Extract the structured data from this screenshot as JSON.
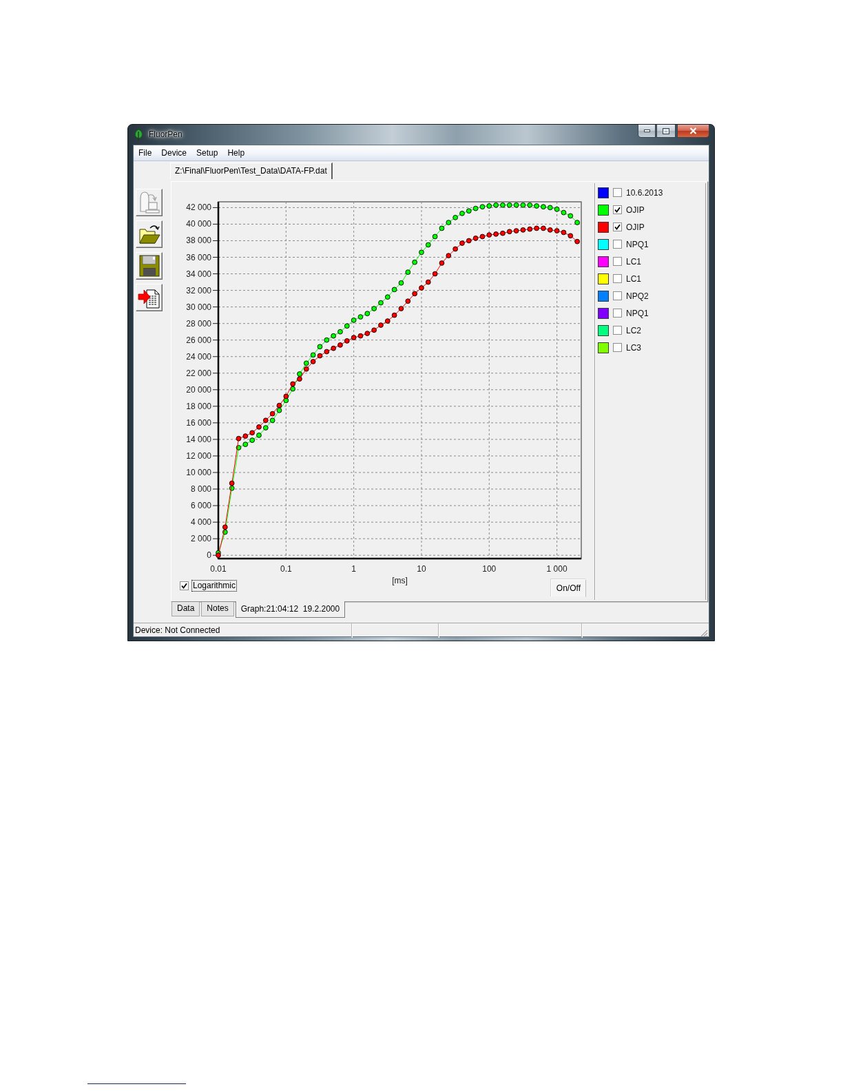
{
  "window": {
    "title": "FluorPen"
  },
  "menu": [
    "File",
    "Device",
    "Setup",
    "Help"
  ],
  "file_tabs": [
    {
      "label": "Z:\\Final\\FluorPen\\Test_Data\\DATA-FP.dat",
      "selected": true
    }
  ],
  "toolbar": [
    {
      "disabled": true
    },
    {
      "disabled": false
    },
    {
      "disabled": false
    },
    {
      "disabled": false
    }
  ],
  "chart": {
    "chart_data": {
      "type": "line",
      "xlabel": "[ms]",
      "grid": true,
      "categories": [
        "0.01",
        null,
        null,
        null,
        null,
        null,
        null,
        null,
        null,
        null,
        "0.1",
        null,
        null,
        null,
        null,
        null,
        null,
        null,
        null,
        null,
        "1",
        null,
        null,
        null,
        null,
        null,
        null,
        null,
        null,
        null,
        "10",
        null,
        null,
        null,
        null,
        null,
        null,
        null,
        null,
        null,
        "100",
        null,
        null,
        null,
        null,
        null,
        null,
        null,
        null,
        null,
        "1 000",
        null,
        null,
        null
      ],
      "series": [
        {
          "color": "#00ff00",
          "marker": "circle",
          "values": [
            300,
            2800,
            8100,
            13000,
            13400,
            13900,
            14500,
            15400,
            16300,
            17500,
            18700,
            20100,
            21900,
            23200,
            24200,
            25200,
            26000,
            26500,
            27000,
            27700,
            28400,
            28800,
            29200,
            29800,
            30500,
            31200,
            32100,
            32900,
            34200,
            35400,
            36600,
            37500,
            38500,
            39500,
            40200,
            40800,
            41300,
            41600,
            41900,
            42100,
            42200,
            42300,
            42300,
            42300,
            42300,
            42300,
            42300,
            42200,
            42100,
            42000,
            41800,
            41400,
            41000,
            40200
          ]
        },
        {
          "color": "#ff0000",
          "marker": "circle",
          "values": [
            0,
            3400,
            8700,
            14100,
            14400,
            14800,
            15500,
            16300,
            17100,
            18100,
            19200,
            20700,
            21300,
            22500,
            23400,
            24100,
            24600,
            25000,
            25400,
            25900,
            26300,
            26500,
            26800,
            27200,
            27800,
            28300,
            29000,
            29800,
            30700,
            31600,
            32300,
            33000,
            34000,
            35300,
            36200,
            37000,
            37700,
            38000,
            38300,
            38500,
            38700,
            38800,
            38900,
            39100,
            39200,
            39300,
            39400,
            39500,
            39500,
            39300,
            39200,
            39000,
            38600,
            37900
          ]
        }
      ],
      "ylim": [
        -400,
        42700
      ],
      "yticks": [
        {
          "value": 0,
          "label": "0"
        },
        {
          "value": 2000,
          "label": "2 000"
        },
        {
          "value": 4000,
          "label": "4 000"
        },
        {
          "value": 6000,
          "label": "6 000"
        },
        {
          "value": 8000,
          "label": "8 000"
        },
        {
          "value": 10000,
          "label": "10 000"
        },
        {
          "value": 12000,
          "label": "12 000"
        },
        {
          "value": 14000,
          "label": "14 000"
        },
        {
          "value": 16000,
          "label": "16 000"
        },
        {
          "value": 18000,
          "label": "18 000"
        },
        {
          "value": 20000,
          "label": "20 000"
        },
        {
          "value": 22000,
          "label": "22 000"
        },
        {
          "value": 24000,
          "label": "24 000"
        },
        {
          "value": 26000,
          "label": "26 000"
        },
        {
          "value": 28000,
          "label": "28 000"
        },
        {
          "value": 30000,
          "label": "30 000"
        },
        {
          "value": 32000,
          "label": "32 000"
        },
        {
          "value": 34000,
          "label": "34 000"
        },
        {
          "value": 36000,
          "label": "36 000"
        },
        {
          "value": 38000,
          "label": "38 000"
        },
        {
          "value": 40000,
          "label": "40 000"
        },
        {
          "value": 42000,
          "label": "42 000"
        }
      ]
    },
    "logarithmic": {
      "label": "Logarithmic",
      "checked": true
    },
    "on_off_button": "On/Off"
  },
  "legend": [
    {
      "label": "10.6.2013",
      "color": "#0000ff",
      "checked": false
    },
    {
      "label": "OJIP",
      "color": "#00ff00",
      "checked": true
    },
    {
      "label": "OJIP",
      "color": "#ff0000",
      "checked": true
    },
    {
      "label": "NPQ1",
      "color": "#00ffff",
      "checked": false
    },
    {
      "label": "LC1",
      "color": "#ff00ff",
      "checked": false
    },
    {
      "label": "LC1",
      "color": "#ffff00",
      "checked": false
    },
    {
      "label": "NPQ2",
      "color": "#0080ff",
      "checked": false
    },
    {
      "label": "NPQ1",
      "color": "#8000ff",
      "checked": false
    },
    {
      "label": "LC2",
      "color": "#00ff80",
      "checked": false
    },
    {
      "label": "LC3",
      "color": "#80ff00",
      "checked": false
    }
  ],
  "bottom_tabs": [
    {
      "label": "Data",
      "selected": false
    },
    {
      "label": "Notes",
      "selected": false
    },
    {
      "label": "Graph:21:04:12  19.2.2000",
      "selected": true
    }
  ],
  "status_bar": {
    "text": "Device: Not Connected"
  }
}
